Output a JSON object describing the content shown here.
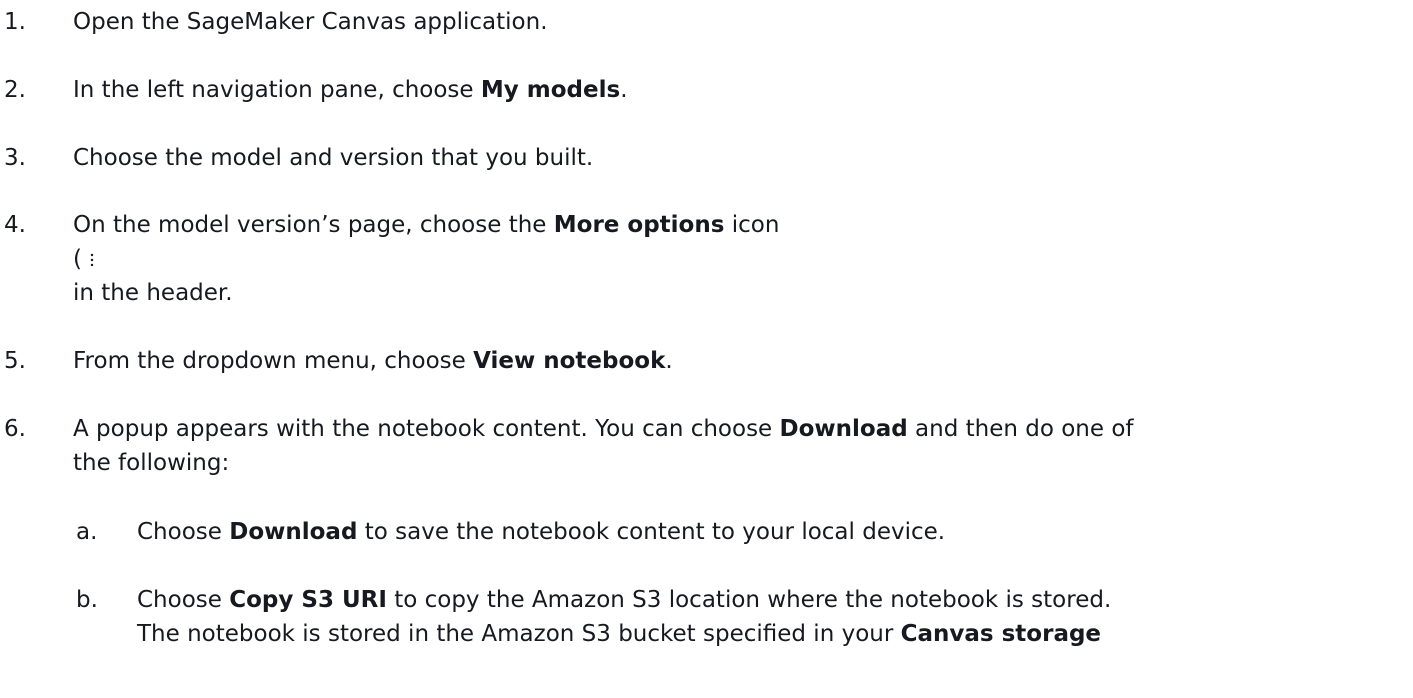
{
  "steps": [
    {
      "num": "1.",
      "text": "Open the SageMaker Canvas application."
    },
    {
      "num": "2.",
      "pre": "In the left navigation pane, choose ",
      "bold": "My models",
      "post": "."
    },
    {
      "num": "3.",
      "text": "Choose the model and version that you built."
    },
    {
      "num": "4.",
      "pre": "On the model version’s page, choose the ",
      "bold": "More options",
      "post": " icon",
      "paren": "(",
      "icon": "more-options-icon",
      "tail": "in the header."
    },
    {
      "num": "5.",
      "pre": "From the dropdown menu, choose ",
      "bold": "View notebook",
      "post": "."
    },
    {
      "num": "6.",
      "pre": "A popup appears with the notebook content. You can choose ",
      "bold": "Download",
      "post": " and then do one of",
      "line2": "the following:"
    }
  ],
  "substeps": [
    {
      "num": "a.",
      "pre": "Choose ",
      "bold": "Download",
      "post": " to save the notebook content to your local device."
    },
    {
      "num": "b.",
      "pre": "Choose ",
      "bold": "Copy S3 URI",
      "post": " to copy the Amazon S3 location where the notebook is stored.",
      "line2_pre": "The notebook is stored in the Amazon S3 bucket specified in your ",
      "line2_bold": "Canvas storage"
    }
  ]
}
